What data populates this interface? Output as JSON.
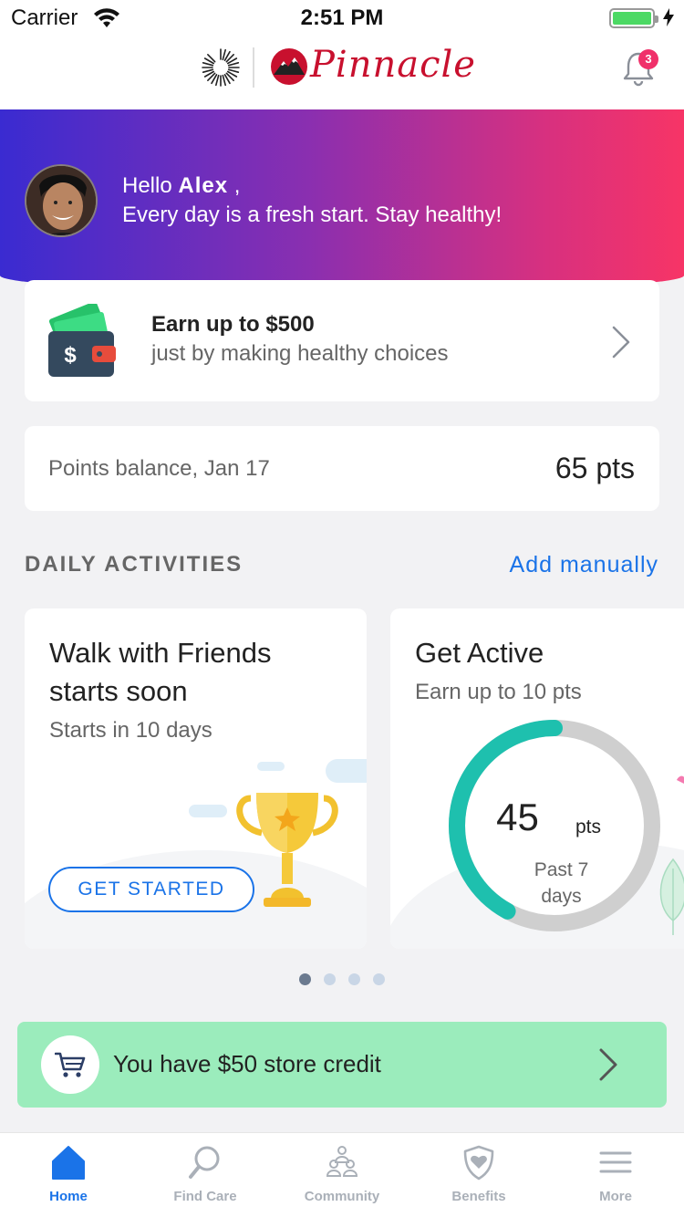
{
  "status_bar": {
    "carrier": "Carrier",
    "time": "2:51 PM"
  },
  "header": {
    "brand_name": "Pinnacle",
    "notification_count": "3"
  },
  "hero": {
    "greeting_prefix": "Hello ",
    "user_name": "Alex",
    "greeting_suffix": " ,",
    "message": "Every day is a fresh start. Stay healthy!"
  },
  "earn_card": {
    "title": "Earn up to $500",
    "subtitle": "just by making healthy choices"
  },
  "points": {
    "label": "Points balance, Jan 17",
    "value": "65 pts"
  },
  "daily_activities": {
    "section_title": "DAILY ACTIVITIES",
    "add_manually": "Add manually",
    "cards": [
      {
        "title_line1": "Walk with Friends",
        "title_line2": "starts soon",
        "subtitle": "Starts in 10 days",
        "button": "GET STARTED"
      },
      {
        "title": "Get Active",
        "subtitle": "Earn up to 10 pts",
        "value": "45",
        "unit": "pts",
        "label_line1": "Past 7",
        "label_line2": "days",
        "progress_fraction": 0.42
      }
    ],
    "pager": {
      "count": 4,
      "active_index": 0
    }
  },
  "credit": {
    "text": "You have $50 store credit"
  },
  "tabs": [
    {
      "label": "Home",
      "icon": "home-icon",
      "active": true
    },
    {
      "label": "Find Care",
      "icon": "search-icon",
      "active": false
    },
    {
      "label": "Community",
      "icon": "community-icon",
      "active": false
    },
    {
      "label": "Benefits",
      "icon": "shield-heart-icon",
      "active": false
    },
    {
      "label": "More",
      "icon": "menu-icon",
      "active": false
    }
  ],
  "colors": {
    "accent": "#1a73e8",
    "ring_progress": "#1ec0ae",
    "ring_track": "#cfcfcf",
    "credit_bg": "#9becbc",
    "hero_start": "#3a2bd1",
    "hero_end": "#f73466"
  }
}
